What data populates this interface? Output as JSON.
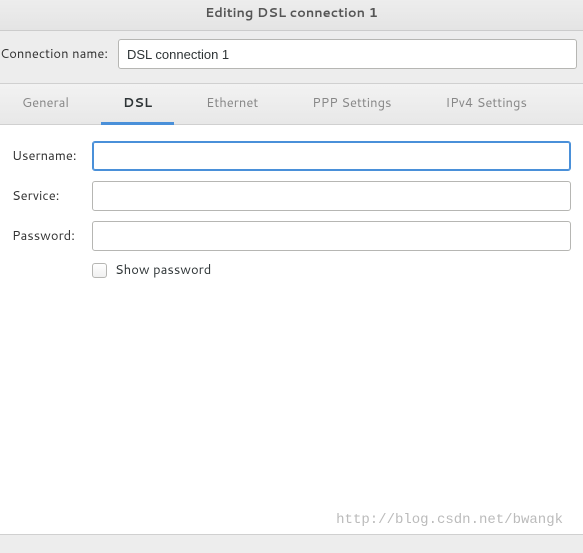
{
  "window": {
    "title": "Editing DSL connection 1"
  },
  "connection": {
    "name_label": "Connection name:",
    "name_value": "DSL connection 1"
  },
  "tabs": {
    "general": "General",
    "dsl": "DSL",
    "ethernet": "Ethernet",
    "ppp": "PPP Settings",
    "ipv4": "IPv4 Settings"
  },
  "form": {
    "username_label": "Username:",
    "username_value": "",
    "service_label": "Service:",
    "service_value": "",
    "password_label": "Password:",
    "password_value": "",
    "show_password_label": "Show password",
    "show_password_checked": false
  },
  "watermark": "http://blog.csdn.net/bwangk"
}
